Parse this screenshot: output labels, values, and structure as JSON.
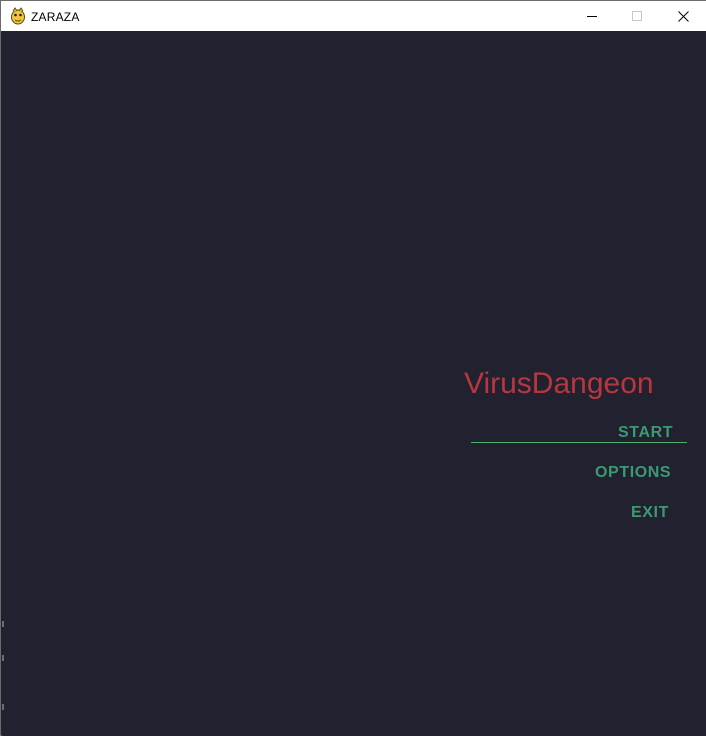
{
  "window": {
    "title": "ZARAZA",
    "icon": "pygame-snake-icon",
    "controls": {
      "minimize_icon": "minimize-icon",
      "maximize_icon": "maximize-icon",
      "close_icon": "close-icon"
    }
  },
  "game": {
    "title": "VirusDangeon",
    "menu": [
      {
        "label": "START",
        "selected": true
      },
      {
        "label": "OPTIONS",
        "selected": false
      },
      {
        "label": "EXIT",
        "selected": false
      }
    ]
  },
  "colors": {
    "background": "#22212f",
    "title": "#b7363f",
    "menu_text": "#3b9a73",
    "selector": "#4bb16c"
  }
}
